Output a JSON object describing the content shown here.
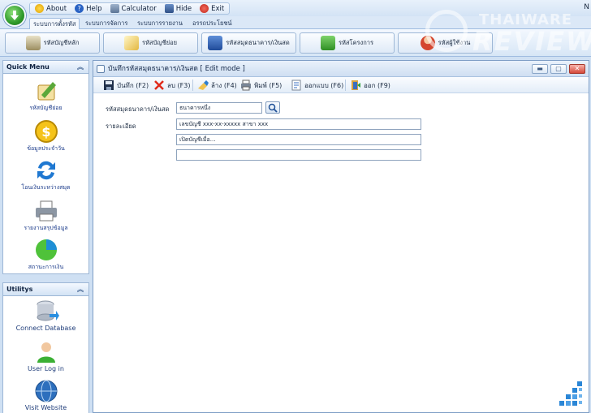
{
  "quick_access": {
    "about": "About",
    "help": "Help",
    "calculator": "Calculator",
    "hide": "Hide",
    "exit": "Exit"
  },
  "top_right_letter": "N",
  "tabs": [
    {
      "label": "ระบบการตั้งรหัส",
      "active": true
    },
    {
      "label": "ระบบการจัดการ",
      "active": false
    },
    {
      "label": "ระบบการรายงาน",
      "active": false
    },
    {
      "label": "อรรถประโยชน์",
      "active": false
    }
  ],
  "ribbon": [
    {
      "label": "รหัสบัญชีหลัก",
      "icon": "ledger-icon"
    },
    {
      "label": "รหัสบัญชีย่อย",
      "icon": "pen-note-icon"
    },
    {
      "label": "รหัสสมุดธนาคาร/เงินสด",
      "icon": "bankbook-icon"
    },
    {
      "label": "รหัสโครงการ",
      "icon": "cubes-icon"
    },
    {
      "label": "รหัสผู้ใช้งาน",
      "icon": "user-icon"
    }
  ],
  "watermark": {
    "line1": "THAIWARE",
    "line2": "REVIEW"
  },
  "sidebar": {
    "quick_menu_title": "Quick Menu",
    "quick_menu": [
      {
        "label": "รหัสบัญชีย่อย",
        "icon": "pen-note-icon"
      },
      {
        "label": "ข้อมูลประจำวัน",
        "icon": "coin-icon"
      },
      {
        "label": "โอนเงินระหว่างสมุด",
        "icon": "transfer-arrows-icon"
      },
      {
        "label": "รายงานสรุปข้อมูล",
        "icon": "printer-icon"
      },
      {
        "label": "สถานะการเงิน",
        "icon": "pie-chart-icon"
      }
    ],
    "utility_title": "Utilitys",
    "utilities": [
      {
        "label": "Connect Database",
        "icon": "database-icon"
      },
      {
        "label": "User Log in",
        "icon": "user-login-icon"
      },
      {
        "label": "Visit Website",
        "icon": "globe-icon"
      }
    ]
  },
  "window": {
    "title": "บันทึกรหัสสมุดธนาคาร/เงินสด [ Edit mode ]",
    "toolbar": [
      {
        "label": "บันทึก (F2)",
        "icon": "save-icon"
      },
      {
        "label": "ลบ (F3)",
        "icon": "delete-icon"
      },
      {
        "label": "ล้าง (F4)",
        "icon": "clear-icon"
      },
      {
        "label": "พิมพ์ (F5)",
        "icon": "print-icon"
      },
      {
        "label": "ออกแบบ (F6)",
        "icon": "design-icon"
      },
      {
        "label": "ออก (F9)",
        "icon": "exit-icon"
      }
    ]
  },
  "form": {
    "code_label": "รหัสสมุดธนาคาร/เงินสด",
    "code_value": "ธนาคารหนึ่ง",
    "detail_label": "รายละเอียด",
    "detail_line1": "เลขบัญชี xxx-xx-xxxxx สาขา xxx",
    "detail_line2": "เปิดบัญชีเมื่อ...",
    "detail_line3": ""
  },
  "colors": {
    "accent": "#2f9a2a",
    "window_border": "#7f9fc6",
    "close_red": "#d5493a"
  }
}
